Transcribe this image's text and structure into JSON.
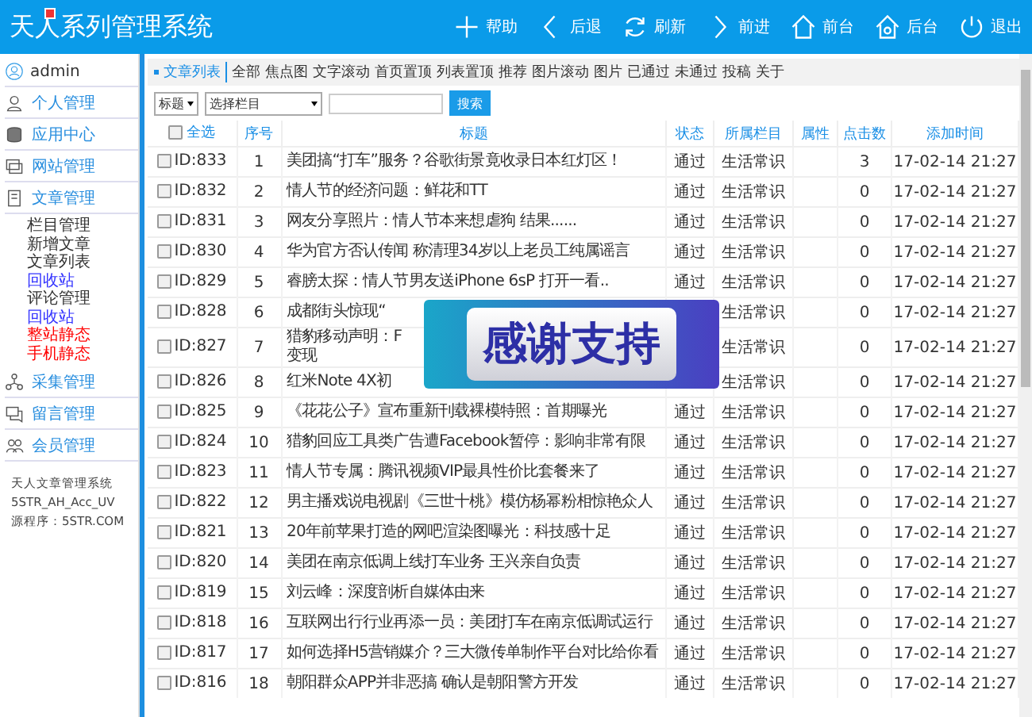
{
  "header": {
    "logo": "天人系列管理系统",
    "nav": [
      {
        "kind": "plus",
        "label": "帮助"
      },
      {
        "kind": "back",
        "label": "后退"
      },
      {
        "kind": "refresh",
        "label": "刷新"
      },
      {
        "kind": "forward",
        "label": "前进"
      },
      {
        "kind": "home",
        "label": "前台"
      },
      {
        "kind": "admin",
        "label": "后台"
      },
      {
        "kind": "power",
        "label": "退出"
      }
    ]
  },
  "sidebar": {
    "user": "admin",
    "sections": [
      {
        "kind": "user",
        "label": "个人管理"
      },
      {
        "kind": "app",
        "label": "应用中心"
      },
      {
        "kind": "site",
        "label": "网站管理"
      },
      {
        "kind": "doc",
        "label": "文章管理",
        "children": [
          {
            "label": "栏目管理",
            "color": "#333333"
          },
          {
            "label": "新增文章",
            "color": "#333333"
          },
          {
            "label": "文章列表",
            "color": "#333333"
          },
          {
            "label": "回收站",
            "color": "#3333ff"
          },
          {
            "label": "评论管理",
            "color": "#333333"
          },
          {
            "label": "回收站",
            "color": "#3333ff"
          },
          {
            "label": "整站静态",
            "color": "#ff0000"
          },
          {
            "label": "手机静态",
            "color": "#ff0000"
          }
        ]
      },
      {
        "kind": "collect",
        "label": "采集管理"
      },
      {
        "kind": "message",
        "label": "留言管理"
      },
      {
        "kind": "members",
        "label": "会员管理"
      }
    ],
    "footer": [
      "天人文章管理系统",
      "5STR_AH_Acc_UV",
      "源程序：5STR.COM"
    ]
  },
  "filters": [
    {
      "label": "文章列表",
      "selected": true
    },
    {
      "label": "全部",
      "selected": false
    },
    {
      "label": "焦点图",
      "selected": false
    },
    {
      "label": "文字滚动",
      "selected": false
    },
    {
      "label": "首页置顶",
      "selected": false
    },
    {
      "label": "列表置顶",
      "selected": false
    },
    {
      "label": "推荐",
      "selected": false
    },
    {
      "label": "图片滚动",
      "selected": false
    },
    {
      "label": "图片",
      "selected": false
    },
    {
      "label": "已通过",
      "selected": false
    },
    {
      "label": "未通过",
      "selected": false
    },
    {
      "label": "投稿",
      "selected": false
    },
    {
      "label": "关于",
      "selected": false
    }
  ],
  "search": {
    "field_select": "标题",
    "column_select": "选择栏目",
    "button": "搜索"
  },
  "table": {
    "select_all": {
      "label": "全选",
      "checked": false
    },
    "columns": [
      "序号",
      "标题",
      "状态",
      "所属栏目",
      "属性",
      "点击数",
      "添加时间"
    ],
    "rows": [
      {
        "id": "ID:833",
        "no": "1",
        "title": "美团搞“打车”服务？谷歌街景竟收录日本红灯区！",
        "status": "通过",
        "category": "生活常识",
        "clicks": "3",
        "time": "17-02-14 21:27",
        "checked": false
      },
      {
        "id": "ID:832",
        "no": "2",
        "title": "情人节的经济问题：鲜花和TT",
        "status": "通过",
        "category": "生活常识",
        "clicks": "0",
        "time": "17-02-14 21:27",
        "checked": false
      },
      {
        "id": "ID:831",
        "no": "3",
        "title": "网友分享照片：情人节本来想虐狗 结果......",
        "status": "通过",
        "category": "生活常识",
        "clicks": "0",
        "time": "17-02-14 21:27",
        "checked": false
      },
      {
        "id": "ID:830",
        "no": "4",
        "title": "华为官方否认传闻 称清理34岁以上老员工纯属谣言",
        "status": "通过",
        "category": "生活常识",
        "clicks": "0",
        "time": "17-02-14 21:27",
        "checked": false
      },
      {
        "id": "ID:829",
        "no": "5",
        "title": "睿膀太探：情人节男友送iPhone 6sP 打开一看..",
        "status": "通过",
        "category": "生活常识",
        "clicks": "0",
        "time": "17-02-14 21:27",
        "checked": false
      },
      {
        "id": "ID:828",
        "no": "6",
        "title": "成都街头惊现“",
        "category": "生活常识",
        "clicks": "0",
        "time": "17-02-14 21:27",
        "checked": false
      },
      {
        "id": "ID:827",
        "no": "7",
        "title": "猎豹移动声明：F",
        "title_line_2": "变现",
        "category": "生活常识",
        "clicks": "0",
        "time": "17-02-14 21:27",
        "checked": false
      },
      {
        "id": "ID:826",
        "no": "8",
        "title": "红米Note 4X初",
        "category": "生活常识",
        "clicks": "0",
        "time": "17-02-14 21:27",
        "checked": false
      },
      {
        "id": "ID:825",
        "no": "9",
        "title": "《花花公子》宣布重新刊载裸模特照：首期曝光",
        "status": "通过",
        "category": "生活常识",
        "clicks": "0",
        "time": "17-02-14 21:27",
        "checked": false
      },
      {
        "id": "ID:824",
        "no": "10",
        "title": "猎豹回应工具类广告遭Facebook暂停：影响非常有限",
        "status": "通过",
        "category": "生活常识",
        "clicks": "0",
        "time": "17-02-14 21:27",
        "checked": false
      },
      {
        "id": "ID:823",
        "no": "11",
        "title": "情人节专属：腾讯视频VIP最具性价比套餐来了",
        "status": "通过",
        "category": "生活常识",
        "clicks": "0",
        "time": "17-02-14 21:27",
        "checked": false
      },
      {
        "id": "ID:822",
        "no": "12",
        "title": "男主播戏说电视剧《三世十桃》模仿杨幂粉相惊艳众人",
        "status": "通过",
        "category": "生活常识",
        "clicks": "0",
        "time": "17-02-14 21:27",
        "checked": false
      },
      {
        "id": "ID:821",
        "no": "13",
        "title": "20年前苹果打造的网吧渲染图曝光：科技感十足",
        "status": "通过",
        "category": "生活常识",
        "clicks": "0",
        "time": "17-02-14 21:27",
        "checked": false
      },
      {
        "id": "ID:820",
        "no": "14",
        "title": "美团在南京低调上线打车业务 王兴亲自负责",
        "status": "通过",
        "category": "生活常识",
        "clicks": "0",
        "time": "17-02-14 21:27",
        "checked": false
      },
      {
        "id": "ID:819",
        "no": "15",
        "title": "刘云峰：深度剖析自媒体由来",
        "status": "通过",
        "category": "生活常识",
        "clicks": "0",
        "time": "17-02-14 21:27",
        "checked": false
      },
      {
        "id": "ID:818",
        "no": "16",
        "title": "互联网出行行业再添一员：美团打车在南京低调试运行",
        "status": "通过",
        "category": "生活常识",
        "clicks": "0",
        "time": "17-02-14 21:27",
        "checked": false
      },
      {
        "id": "ID:817",
        "no": "17",
        "title": "如何选择H5营销媒介？三大微传单制作平台对比给你看",
        "status": "通过",
        "category": "生活常识",
        "clicks": "0",
        "time": "17-02-14 21:27",
        "checked": false
      },
      {
        "id": "ID:816",
        "no": "18",
        "title": "朝阳群众APP并非恶搞 确认是朝阳警方开发",
        "status": "通过",
        "category": "生活常识",
        "clicks": "0",
        "time": "17-02-14 21:27",
        "checked": false
      }
    ]
  },
  "overlay": {
    "text": "感谢支持"
  }
}
